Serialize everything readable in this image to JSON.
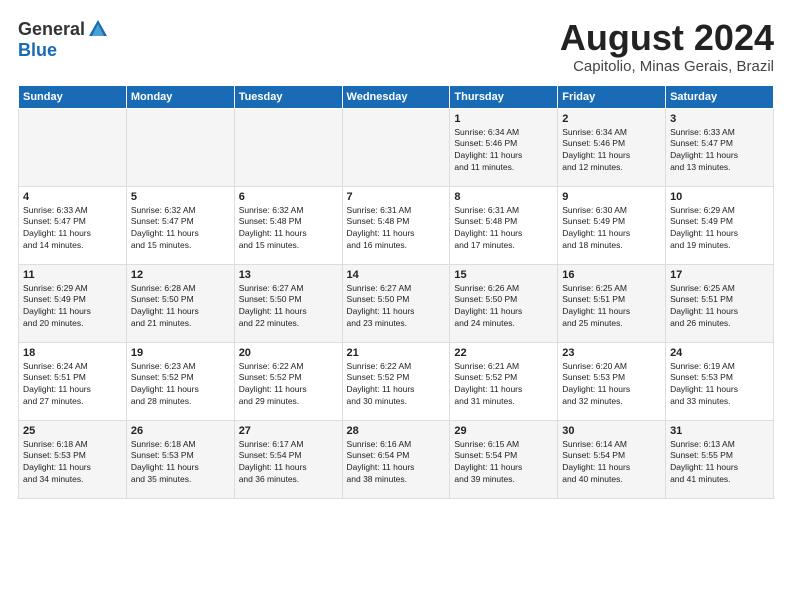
{
  "header": {
    "logo_general": "General",
    "logo_blue": "Blue",
    "title": "August 2024",
    "subtitle": "Capitolio, Minas Gerais, Brazil"
  },
  "weekdays": [
    "Sunday",
    "Monday",
    "Tuesday",
    "Wednesday",
    "Thursday",
    "Friday",
    "Saturday"
  ],
  "weeks": [
    [
      {
        "day": "",
        "info": ""
      },
      {
        "day": "",
        "info": ""
      },
      {
        "day": "",
        "info": ""
      },
      {
        "day": "",
        "info": ""
      },
      {
        "day": "1",
        "info": "Sunrise: 6:34 AM\nSunset: 5:46 PM\nDaylight: 11 hours\nand 11 minutes."
      },
      {
        "day": "2",
        "info": "Sunrise: 6:34 AM\nSunset: 5:46 PM\nDaylight: 11 hours\nand 12 minutes."
      },
      {
        "day": "3",
        "info": "Sunrise: 6:33 AM\nSunset: 5:47 PM\nDaylight: 11 hours\nand 13 minutes."
      }
    ],
    [
      {
        "day": "4",
        "info": "Sunrise: 6:33 AM\nSunset: 5:47 PM\nDaylight: 11 hours\nand 14 minutes."
      },
      {
        "day": "5",
        "info": "Sunrise: 6:32 AM\nSunset: 5:47 PM\nDaylight: 11 hours\nand 15 minutes."
      },
      {
        "day": "6",
        "info": "Sunrise: 6:32 AM\nSunset: 5:48 PM\nDaylight: 11 hours\nand 15 minutes."
      },
      {
        "day": "7",
        "info": "Sunrise: 6:31 AM\nSunset: 5:48 PM\nDaylight: 11 hours\nand 16 minutes."
      },
      {
        "day": "8",
        "info": "Sunrise: 6:31 AM\nSunset: 5:48 PM\nDaylight: 11 hours\nand 17 minutes."
      },
      {
        "day": "9",
        "info": "Sunrise: 6:30 AM\nSunset: 5:49 PM\nDaylight: 11 hours\nand 18 minutes."
      },
      {
        "day": "10",
        "info": "Sunrise: 6:29 AM\nSunset: 5:49 PM\nDaylight: 11 hours\nand 19 minutes."
      }
    ],
    [
      {
        "day": "11",
        "info": "Sunrise: 6:29 AM\nSunset: 5:49 PM\nDaylight: 11 hours\nand 20 minutes."
      },
      {
        "day": "12",
        "info": "Sunrise: 6:28 AM\nSunset: 5:50 PM\nDaylight: 11 hours\nand 21 minutes."
      },
      {
        "day": "13",
        "info": "Sunrise: 6:27 AM\nSunset: 5:50 PM\nDaylight: 11 hours\nand 22 minutes."
      },
      {
        "day": "14",
        "info": "Sunrise: 6:27 AM\nSunset: 5:50 PM\nDaylight: 11 hours\nand 23 minutes."
      },
      {
        "day": "15",
        "info": "Sunrise: 6:26 AM\nSunset: 5:50 PM\nDaylight: 11 hours\nand 24 minutes."
      },
      {
        "day": "16",
        "info": "Sunrise: 6:25 AM\nSunset: 5:51 PM\nDaylight: 11 hours\nand 25 minutes."
      },
      {
        "day": "17",
        "info": "Sunrise: 6:25 AM\nSunset: 5:51 PM\nDaylight: 11 hours\nand 26 minutes."
      }
    ],
    [
      {
        "day": "18",
        "info": "Sunrise: 6:24 AM\nSunset: 5:51 PM\nDaylight: 11 hours\nand 27 minutes."
      },
      {
        "day": "19",
        "info": "Sunrise: 6:23 AM\nSunset: 5:52 PM\nDaylight: 11 hours\nand 28 minutes."
      },
      {
        "day": "20",
        "info": "Sunrise: 6:22 AM\nSunset: 5:52 PM\nDaylight: 11 hours\nand 29 minutes."
      },
      {
        "day": "21",
        "info": "Sunrise: 6:22 AM\nSunset: 5:52 PM\nDaylight: 11 hours\nand 30 minutes."
      },
      {
        "day": "22",
        "info": "Sunrise: 6:21 AM\nSunset: 5:52 PM\nDaylight: 11 hours\nand 31 minutes."
      },
      {
        "day": "23",
        "info": "Sunrise: 6:20 AM\nSunset: 5:53 PM\nDaylight: 11 hours\nand 32 minutes."
      },
      {
        "day": "24",
        "info": "Sunrise: 6:19 AM\nSunset: 5:53 PM\nDaylight: 11 hours\nand 33 minutes."
      }
    ],
    [
      {
        "day": "25",
        "info": "Sunrise: 6:18 AM\nSunset: 5:53 PM\nDaylight: 11 hours\nand 34 minutes."
      },
      {
        "day": "26",
        "info": "Sunrise: 6:18 AM\nSunset: 5:53 PM\nDaylight: 11 hours\nand 35 minutes."
      },
      {
        "day": "27",
        "info": "Sunrise: 6:17 AM\nSunset: 5:54 PM\nDaylight: 11 hours\nand 36 minutes."
      },
      {
        "day": "28",
        "info": "Sunrise: 6:16 AM\nSunset: 6:54 PM\nDaylight: 11 hours\nand 38 minutes."
      },
      {
        "day": "29",
        "info": "Sunrise: 6:15 AM\nSunset: 5:54 PM\nDaylight: 11 hours\nand 39 minutes."
      },
      {
        "day": "30",
        "info": "Sunrise: 6:14 AM\nSunset: 5:54 PM\nDaylight: 11 hours\nand 40 minutes."
      },
      {
        "day": "31",
        "info": "Sunrise: 6:13 AM\nSunset: 5:55 PM\nDaylight: 11 hours\nand 41 minutes."
      }
    ]
  ]
}
